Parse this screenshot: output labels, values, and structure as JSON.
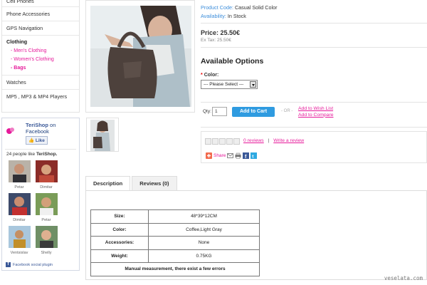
{
  "sidebar": {
    "categories": [
      {
        "label": "Cell Phones"
      },
      {
        "label": "Phone Accessories"
      },
      {
        "label": "GPS Navigation"
      },
      {
        "label": "Clothing"
      },
      {
        "label": "Watches"
      },
      {
        "label": "MP5 , MP3 & MP4 Players"
      }
    ],
    "subcategories": [
      {
        "label": "- Men's Clothing"
      },
      {
        "label": "- Women's Clothing"
      },
      {
        "label": "- Bags"
      }
    ]
  },
  "facebook": {
    "page_name": "TeriShop",
    "page_suffix": "on",
    "page_suffix2": "Facebook",
    "like_button": "Like",
    "count_prefix": "24 people like",
    "count_name": "TeriShop.",
    "faces": [
      {
        "name": "Petar"
      },
      {
        "name": "Dimitar"
      },
      {
        "name": "Dimitar"
      },
      {
        "name": "Petar"
      },
      {
        "name": "Ventsislav"
      },
      {
        "name": "Shelly"
      }
    ],
    "plugin_label": "Facebook social plugin",
    "logo_text": "TERISHOP"
  },
  "product": {
    "code_label": "Product Code:",
    "code_value": "Casual Solid Color",
    "availability_label": "Availability:",
    "availability_value": "In Stock",
    "price": "Price: 25.50€",
    "ex_tax": "Ex Tax: 25.50€",
    "options_title": "Available Options",
    "color_required": "*",
    "color_label": "Color:",
    "color_select": "--- Please Select ---",
    "qty_label": "Qty:",
    "qty_value": "1",
    "add_to_cart": "Add to Cart",
    "or_text": "- OR -",
    "wish_list": "Add to Wish List",
    "compare": "Add to Compare",
    "reviews_link": "0 reviews",
    "review_sep": "|",
    "write_review": "Write a review",
    "share": "Share"
  },
  "tabs": [
    {
      "label": "Description"
    },
    {
      "label": "Reviews (0)"
    }
  ],
  "specs": {
    "rows": [
      {
        "key": "Size:",
        "value": "48*39*12CM"
      },
      {
        "key": "Color:",
        "value": "Coffee,Light Gray"
      },
      {
        "key": "Accessories:",
        "value": "None"
      },
      {
        "key": "Weight:",
        "value": "0.75KG"
      }
    ],
    "note": "Manual measurement, there exist a few errors"
  },
  "watermark": "veselata.com",
  "colors": {
    "accent_pink": "#e6199a",
    "accent_blue": "#3d8edb",
    "cart_button": "#2f9be0",
    "facebook_blue": "#3b5998"
  }
}
